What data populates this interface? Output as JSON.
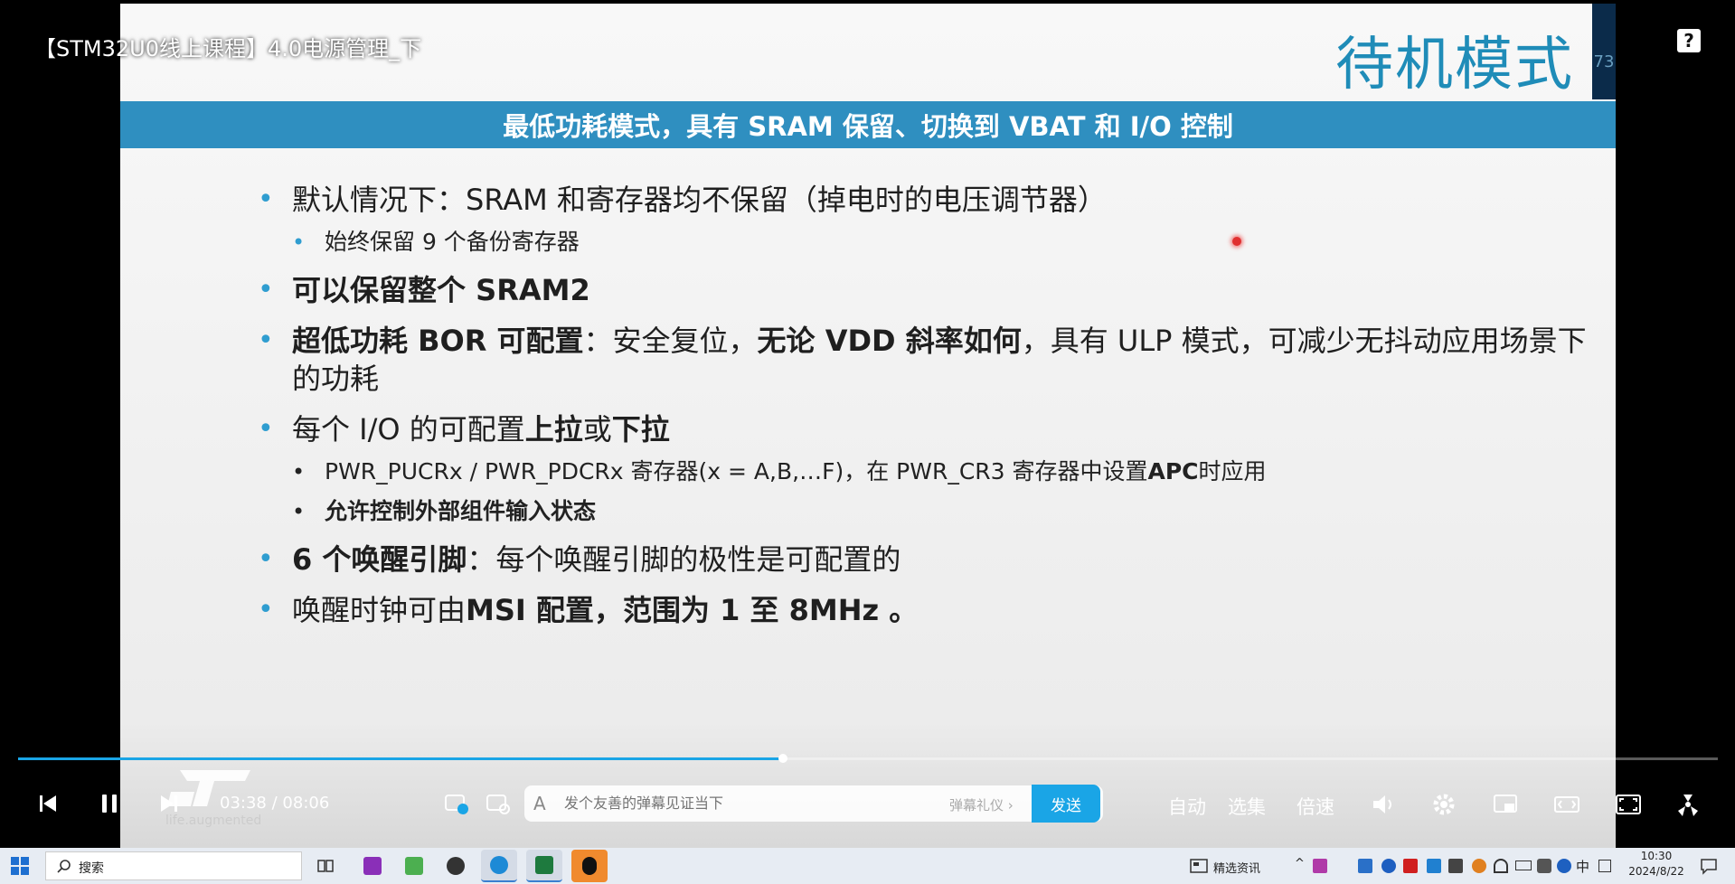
{
  "video": {
    "title": "【STM32U0线上课程】4.0电源管理_下",
    "help_icon": "?"
  },
  "slide": {
    "title": "待机模式",
    "page_number": "73",
    "subtitle": "最低功耗模式，具有 SRAM 保留、切换到 VBAT 和 I/O 控制",
    "bullet1": "默认情况下：SRAM 和寄存器均不保留（掉电时的电压调节器）",
    "bullet1_sub": "始终保留 9 个备份寄存器",
    "bullet2": "可以保留整个 SRAM2",
    "bullet3_bold1": "超低功耗 BOR 可配置",
    "bullet3_text1": "：安全复位，",
    "bullet3_bold2": "无论 VDD 斜率如何",
    "bullet3_text2": "，具有 ULP 模式，可减少无抖动应用场景下的功耗",
    "bullet4_text1": "每个 I/O 的可配置",
    "bullet4_bold1": "上拉",
    "bullet4_text2": "或",
    "bullet4_bold2": "下拉",
    "bullet4_sub1_text": "PWR_PUCRx / PWR_PDCRx 寄存器(x = A,B,…F)，在 PWR_CR3 寄存器中设置",
    "bullet4_sub1_bold": "APC",
    "bullet4_sub1_tail": "时应用",
    "bullet4_sub2": "允许控制外部组件输入状态",
    "bullet5_bold": "6 个唤醒引脚",
    "bullet5_text": "：每个唤醒引脚的极性是可配置的",
    "bullet6_text": "唤醒时钟可由",
    "bullet6_bold": "MSI 配置，范围为 1 至 8MHz 。",
    "logo_text": "life.augmented"
  },
  "player": {
    "current_time": "03:38",
    "separator": "/",
    "duration": "08:06",
    "progress_fraction": 0.45,
    "danmaku_placeholder": "发个友善的弹幕见证当下",
    "danmaku_etiquette": "弹幕礼仪 ›",
    "send_label": "发送",
    "auto_label": "自动",
    "episodes_label": "选集",
    "speed_label": "倍速"
  },
  "taskbar": {
    "search_label": "搜索",
    "news_label": "精选资讯",
    "ime_label": "中",
    "time": "10:30",
    "date": "2024/8/22"
  },
  "colors": {
    "accent": "#1aa5e6",
    "slide_band": "#2f8fc0",
    "slide_title": "#1f8cb8"
  }
}
